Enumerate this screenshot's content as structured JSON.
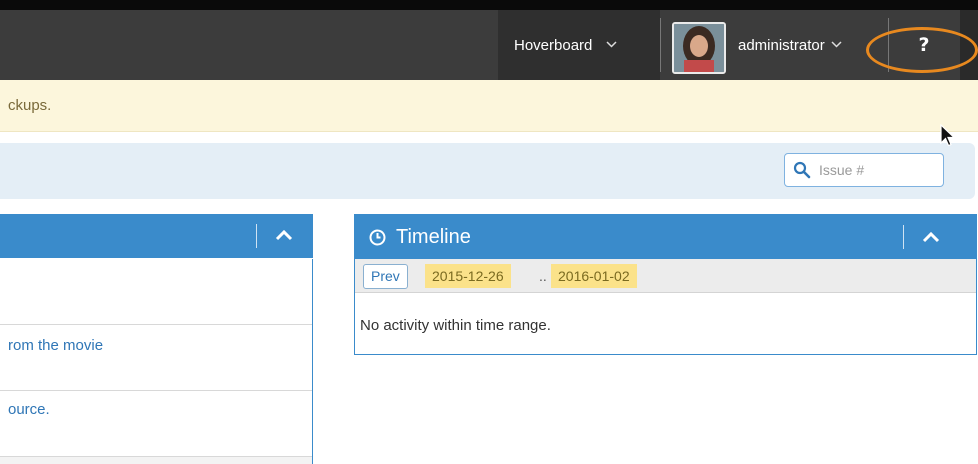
{
  "navbar": {
    "project_label": "Hoverboard",
    "user_label": "administrator",
    "help_label": "?"
  },
  "alert": {
    "text": "ckups."
  },
  "filter": {
    "search_placeholder": "Issue #"
  },
  "left_panel": {
    "items": [
      {
        "text": "rom the movie"
      },
      {
        "text": "ource."
      }
    ]
  },
  "timeline": {
    "title": "Timeline",
    "prev_label": "Prev",
    "range_start": "2015-12-26",
    "range_separator": "..",
    "range_end": "2016-01-02",
    "empty_message": "No activity within time range."
  },
  "colors": {
    "navbar": "#3c3c3c",
    "panel_header": "#3a8bcb",
    "alert_bg": "#fcf6dc",
    "filter_bg": "#e4eef6",
    "date_chip": "#fbe28a",
    "highlight": "#e8891f"
  },
  "icons": {
    "project_dropdown": "chevron-down-icon",
    "user_dropdown": "chevron-down-icon",
    "search": "search-icon",
    "timeline": "clock-icon",
    "collapse": "caret-up-icon"
  }
}
